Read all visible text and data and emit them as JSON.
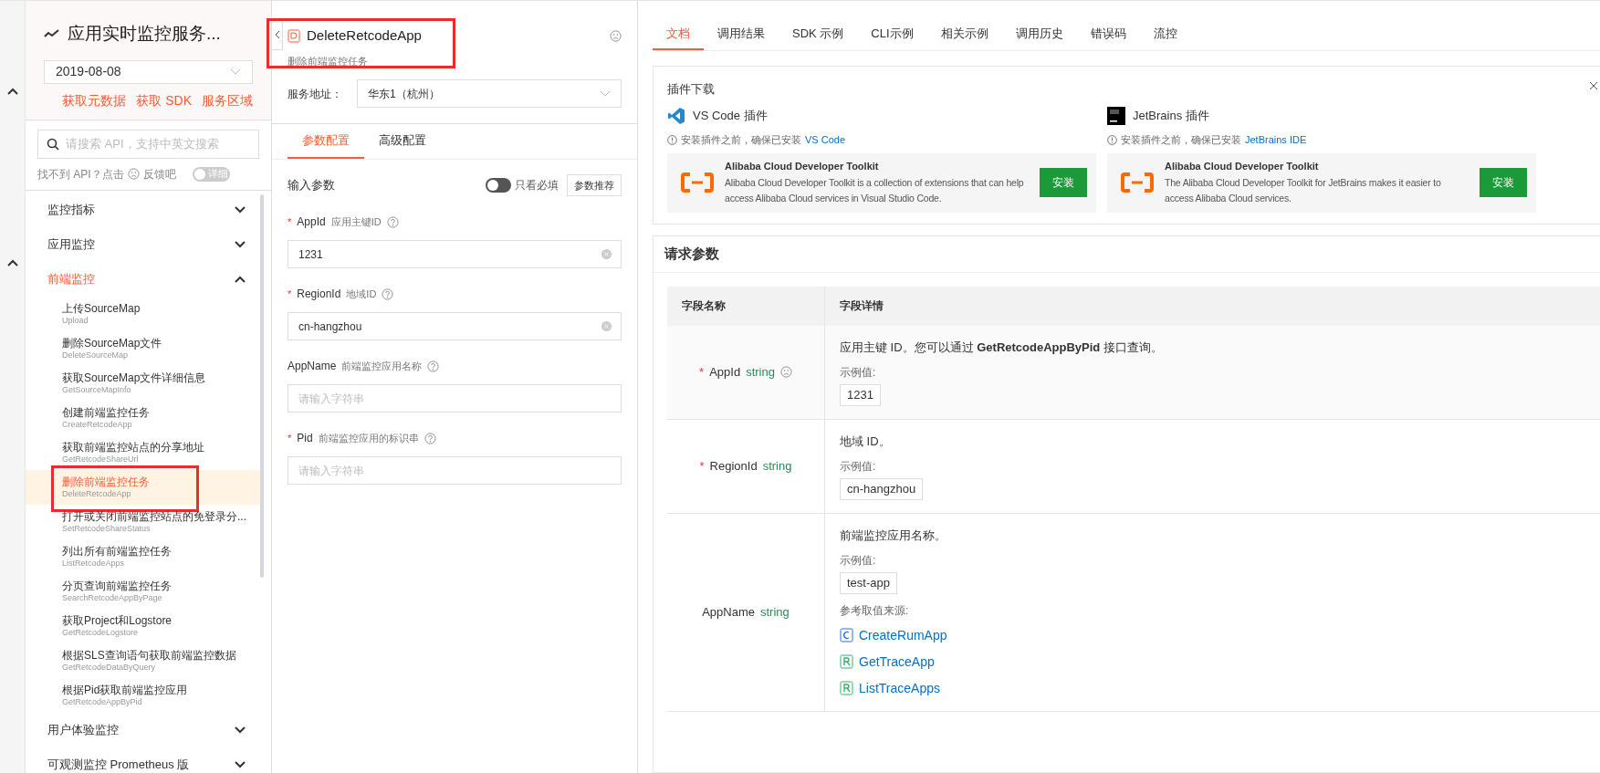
{
  "sidebar": {
    "title": "应用实时监控服务...",
    "version": "2019-08-08",
    "links": [
      "获取元数据",
      "获取 SDK",
      "服务区域"
    ],
    "search": {
      "placeholder": "请搜索 API，支持中英文搜索"
    },
    "feedback": {
      "before": "找不到 API？点击",
      "after": "反馈吧"
    },
    "detail_toggle": {
      "label": "详细",
      "on": false
    },
    "groups": [
      {
        "label": "监控指标",
        "expanded": false
      },
      {
        "label": "应用监控",
        "expanded": false
      },
      {
        "label": "前端监控",
        "expanded": true,
        "children": [
          {
            "title": "上传SourceMap",
            "api": "Upload",
            "selected": false
          },
          {
            "title": "删除SourceMap文件",
            "api": "DeleteSourceMap",
            "selected": false
          },
          {
            "title": "获取SourceMap文件详细信息",
            "api": "GetSourceMapInfo",
            "selected": false
          },
          {
            "title": "创建前端监控任务",
            "api": "CreateRetcodeApp",
            "selected": false
          },
          {
            "title": "获取前端监控站点的分享地址",
            "api": "GetRetcodeShareUrl",
            "selected": false
          },
          {
            "title": "删除前端监控任务",
            "api": "DeleteRetcodeApp",
            "selected": true
          },
          {
            "title": "打开或关闭前端监控站点的免登录分...",
            "api": "SetRetcodeShareStatus",
            "selected": false
          },
          {
            "title": "列出所有前端监控任务",
            "api": "ListRetcodeApps",
            "selected": false
          },
          {
            "title": "分页查询前端监控任务",
            "api": "SearchRetcodeAppByPage",
            "selected": false
          },
          {
            "title": "获取Project和Logstore",
            "api": "GetRetcodeLogstore",
            "selected": false
          },
          {
            "title": "根据SLS查询语句获取前端监控数据",
            "api": "GetRetcodeDataByQuery",
            "selected": false
          },
          {
            "title": "根据Pid获取前端监控应用",
            "api": "GetRetcodeAppByPid",
            "selected": false
          }
        ]
      },
      {
        "label": "用户体验监控",
        "expanded": false
      },
      {
        "label": "可观测监控 Prometheus 版",
        "expanded": false
      }
    ]
  },
  "api": {
    "name": "DeleteRetcodeApp",
    "subtitle": "删除前端监控任务",
    "endpoint_label": "服务地址：",
    "endpoint": "华东1（杭州）",
    "tabs": [
      {
        "label": "参数配置",
        "selected": true
      },
      {
        "label": "高级配置",
        "selected": false
      }
    ],
    "section": "输入参数",
    "required_only": {
      "label": "只看必填",
      "on": false
    },
    "recommend_button": "参数推荐",
    "params": [
      {
        "required_mark": "*",
        "name": "AppId",
        "desc": "应用主键ID",
        "value": "1231"
      },
      {
        "required_mark": "*",
        "name": "RegionId",
        "desc": "地域ID",
        "value": "cn-hangzhou"
      },
      {
        "name": "AppName",
        "desc": "前端监控应用名称",
        "placeholder": "请输入字符串"
      },
      {
        "required_mark": "*",
        "name": "Pid",
        "desc": "前端监控应用的标识串",
        "placeholder": "请输入字符串"
      }
    ]
  },
  "docs": {
    "tabs": [
      {
        "label": "文档",
        "selected": true
      },
      {
        "label": "调用结果",
        "selected": false
      },
      {
        "label": "SDK 示例",
        "selected": false
      },
      {
        "label": "CLI示例",
        "selected": false
      },
      {
        "label": "相关示例",
        "selected": false
      },
      {
        "label": "调用历史",
        "selected": false
      },
      {
        "label": "错误码",
        "selected": false
      },
      {
        "label": "流控",
        "selected": false
      }
    ],
    "plugins": {
      "title": "插件下载",
      "items": [
        {
          "kind": "vscode",
          "name": "VS Code 插件",
          "note": "安装插件之前，确保已安装",
          "link": "VS Code",
          "toolkit_title": "Alibaba Cloud Developer Toolkit",
          "toolkit_desc": "Alibaba Cloud Developer Toolkit is a collection of extensions that can help access Alibaba Cloud services in Visual Studio Code.",
          "button": "安装"
        },
        {
          "kind": "jetbrains",
          "name": "JetBrains 插件",
          "note": "安装插件之前，确保已安装",
          "link": "JetBrains IDE",
          "toolkit_title": "Alibaba Cloud Developer Toolkit",
          "toolkit_desc": "The Alibaba Cloud Developer Toolkit for JetBrains makes it easier to access Alibaba Cloud services.",
          "button": "安装"
        }
      ]
    },
    "request_params": {
      "title": "请求参数",
      "columns": [
        "字段名称",
        "字段详情"
      ],
      "rows": [
        {
          "required_mark": "*",
          "name": "AppId",
          "type": "string",
          "note_icon": true,
          "description": "应用主键 ID。您可以通过 **GetRetcodeAppByPid** 接口查询。",
          "example_label": "示例值:",
          "example": "1231"
        },
        {
          "required_mark": "*",
          "name": "RegionId",
          "type": "string",
          "description": "地域 ID。",
          "example_label": "示例值:",
          "example": "cn-hangzhou"
        },
        {
          "name": "AppName",
          "type": "string",
          "description": "前端监控应用名称。",
          "example_label": "示例值:",
          "example": "test-app",
          "sources_label": "参考取值来源:",
          "sources": [
            {
              "kind": "create",
              "name": "CreateRumApp"
            },
            {
              "kind": "read",
              "name": "GetTraceApp"
            },
            {
              "kind": "read",
              "name": "ListTraceApps"
            }
          ]
        }
      ]
    }
  }
}
